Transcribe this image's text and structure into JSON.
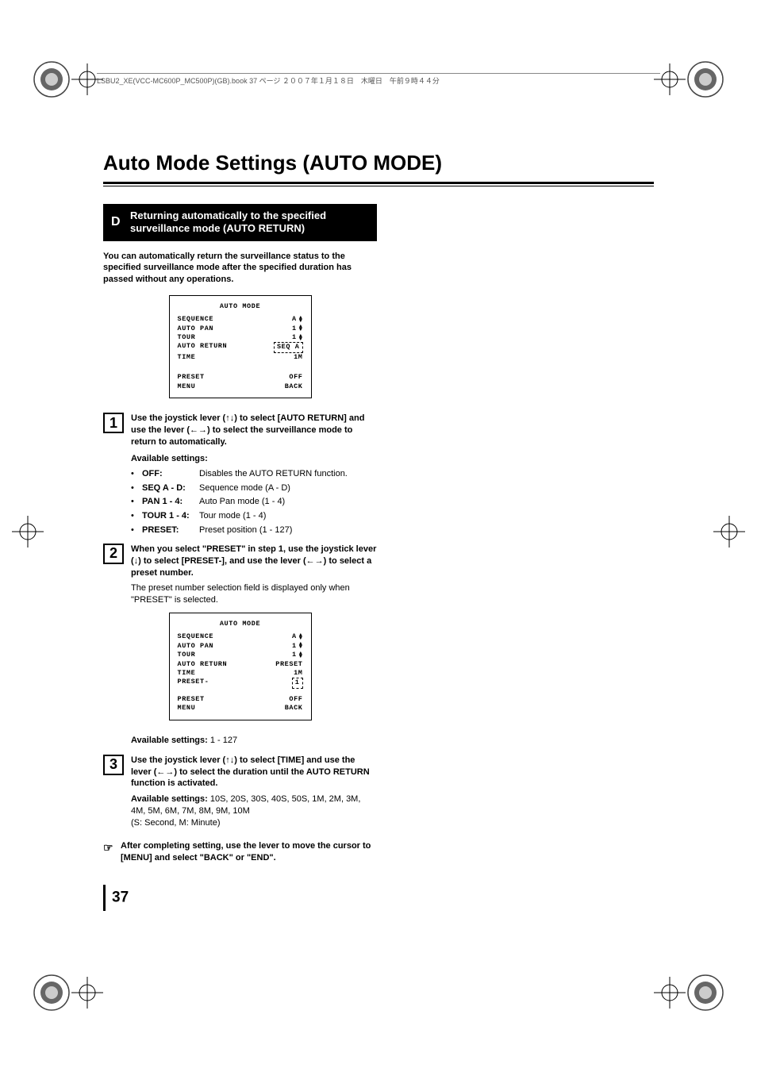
{
  "header_line": "LSBU2_XE(VCC-MC600P_MC500P)(GB).book  37 ページ  ２００７年１月１８日　木曜日　午前９時４４分",
  "page_title": "Auto Mode Settings (AUTO MODE)",
  "section": {
    "letter": "D",
    "title": "Returning automatically to the specified surveillance mode (AUTO RETURN)"
  },
  "intro": "You can automatically return the surveillance status to the specified surveillance mode after the specified duration has passed without any operations.",
  "osd1": {
    "title": "AUTO MODE",
    "rows": [
      {
        "l": "SEQUENCE",
        "r": "A",
        "arrow": true
      },
      {
        "l": "AUTO PAN",
        "r": "1",
        "arrow": true
      },
      {
        "l": "TOUR",
        "r": "1",
        "arrow": true
      },
      {
        "l": "AUTO RETURN",
        "r": "SEQ A",
        "dashed": true
      },
      {
        "l": " TIME",
        "r": "1M"
      }
    ],
    "footer": [
      {
        "l": "PRESET",
        "r": "OFF"
      },
      {
        "l": "MENU",
        "r": "BACK"
      }
    ]
  },
  "step1": {
    "num": "1",
    "head": "Use the joystick lever (↑↓) to select [AUTO RETURN] and use the lever (←→) to select the surveillance mode to return to automatically.",
    "settings_label": "Available settings:",
    "settings": [
      {
        "label": "OFF:",
        "desc": "Disables the AUTO RETURN function."
      },
      {
        "label": "SEQ A - D:",
        "desc": "Sequence mode (A - D)"
      },
      {
        "label": "PAN 1 - 4:",
        "desc": "Auto Pan mode (1 - 4)"
      },
      {
        "label": "TOUR 1 - 4:",
        "desc": "Tour mode (1 - 4)"
      },
      {
        "label": "PRESET:",
        "desc": "Preset position (1 - 127)"
      }
    ]
  },
  "step2": {
    "num": "2",
    "head": "When you select \"PRESET\" in step 1, use the joystick lever (↓) to select [PRESET-], and use the lever (←→) to select a preset number.",
    "body": "The preset number selection field is displayed only when \"PRESET\" is selected."
  },
  "osd2": {
    "title": "AUTO MODE",
    "rows": [
      {
        "l": "SEQUENCE",
        "r": "A",
        "arrow": true
      },
      {
        "l": "AUTO PAN",
        "r": "1",
        "arrow": true
      },
      {
        "l": "TOUR",
        "r": "1",
        "arrow": true
      },
      {
        "l": "AUTO RETURN",
        "r": "PRESET"
      },
      {
        "l": " TIME",
        "r": "1M"
      },
      {
        "l": "      PRESET-",
        "r": "1",
        "dashed": true
      }
    ],
    "footer": [
      {
        "l": "PRESET",
        "r": "OFF"
      },
      {
        "l": "MENU",
        "r": "BACK"
      }
    ]
  },
  "step2_settings": {
    "label": "Available settings:",
    "value": "1 - 127"
  },
  "step3": {
    "num": "3",
    "head": "Use the joystick lever (↑↓) to select [TIME] and use the lever (←→) to select the duration until the AUTO RETURN function is activated.",
    "settings_label": "Available settings:",
    "settings_value": "10S, 20S, 30S, 40S, 50S, 1M, 2M, 3M, 4M, 5M, 6M, 7M, 8M, 9M, 10M\n(S: Second, M: Minute)"
  },
  "note": "After completing setting, use the lever to move the cursor to [MENU] and select \"BACK\" or \"END\".",
  "page_number": "37"
}
